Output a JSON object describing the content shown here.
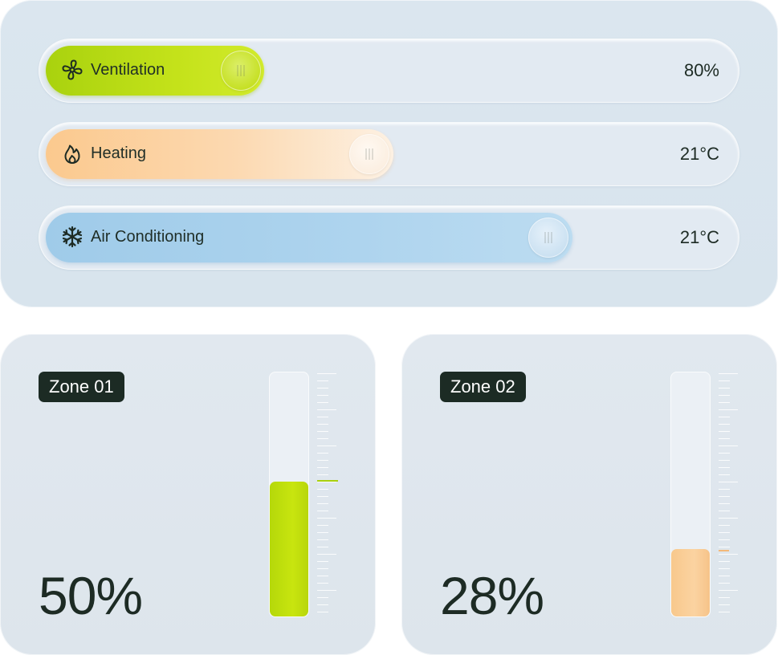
{
  "controls": [
    {
      "label": "Ventilation",
      "value": "80%",
      "icon": "fan-icon"
    },
    {
      "label": "Heating",
      "value": "21°C",
      "icon": "flame-icon"
    },
    {
      "label": "Air Conditioning",
      "value": "21°C",
      "icon": "snowflake-icon"
    }
  ],
  "control_levels": {
    "ventilation": 0.32,
    "heating": 0.5,
    "air_conditioning": 0.76
  },
  "zones": [
    {
      "name": "Zone 01",
      "value": "50%",
      "level": 0.55,
      "accent": "#c4e21a"
    },
    {
      "name": "Zone 02",
      "value": "28%",
      "level": 0.28,
      "accent": "#f9c98f"
    }
  ],
  "colors": {
    "ventilation": "#c4e21a",
    "heating": "#fbc98e",
    "air_conditioning": "#aed4ee",
    "badge_bg": "#1c2b24",
    "text": "#1d2b24"
  }
}
